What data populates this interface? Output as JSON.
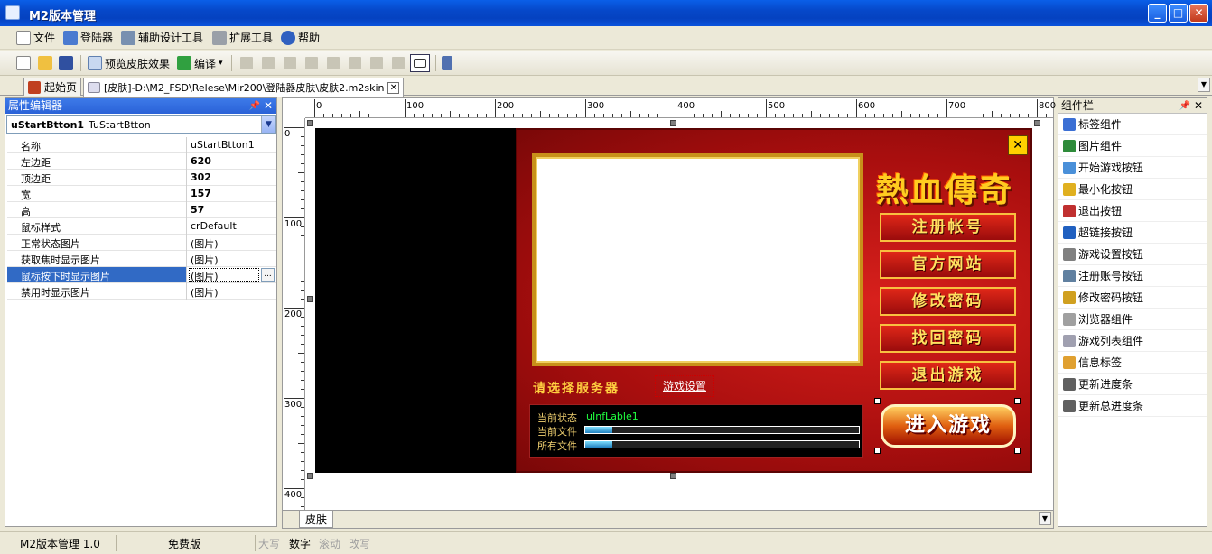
{
  "window": {
    "title": "M2版本管理",
    "min_label": "_",
    "max_label": "□",
    "close_label": "✕"
  },
  "menu": [
    {
      "label": "文件",
      "icon": "file-icon"
    },
    {
      "label": "登陆器",
      "icon": "monitor-icon"
    },
    {
      "label": "辅助设计工具",
      "icon": "tools-icon"
    },
    {
      "label": "扩展工具",
      "icon": "wrench-icon"
    },
    {
      "label": "帮助",
      "icon": "help-icon"
    }
  ],
  "toolbar": {
    "preview_label": "预览皮肤效果",
    "compile_label": "编译",
    "compile_arrow": "▾"
  },
  "tabs": [
    {
      "label": "起始页",
      "icon": "home-icon"
    },
    {
      "label": "[皮肤]-D:\\M2_FSD\\Relese\\Mir200\\登陆器皮肤\\皮肤2.m2skin",
      "icon": "doc-icon"
    }
  ],
  "tab_close": "✕",
  "tab_scroll": "▼",
  "inspector": {
    "title": "属性编辑器",
    "pin": "📌",
    "close": "✕",
    "object_name": "uStartBtton1",
    "object_class": "TuStartBtton",
    "dropdown": "▼",
    "ellipsis": "...",
    "props": [
      {
        "key": "名称",
        "value": "uStartBtton1",
        "bold": false
      },
      {
        "key": "左边距",
        "value": "620",
        "bold": true
      },
      {
        "key": "顶边距",
        "value": "302",
        "bold": true
      },
      {
        "key": "宽",
        "value": "157",
        "bold": true
      },
      {
        "key": "高",
        "value": "57",
        "bold": true
      },
      {
        "key": "鼠标样式",
        "value": "crDefault",
        "bold": false
      },
      {
        "key": "正常状态图片",
        "value": "(图片)",
        "bold": false
      },
      {
        "key": "获取焦时显示图片",
        "value": "(图片)",
        "bold": false
      },
      {
        "key": "鼠标按下时显示图片",
        "value": "(图片)",
        "bold": false,
        "selected": true
      },
      {
        "key": "禁用时显示图片",
        "value": "(图片)",
        "bold": false
      }
    ]
  },
  "ruler": {
    "top": [
      "0",
      "100",
      "200",
      "300",
      "400",
      "500",
      "600",
      "700",
      "800"
    ],
    "left": [
      "0",
      "100",
      "200",
      "300",
      "400"
    ]
  },
  "skin": {
    "close": "✕",
    "brand": "熱血傳奇",
    "buttons": [
      "注册帐号",
      "官方网站",
      "修改密码",
      "找回密码",
      "退出游戏"
    ],
    "server_label": "请选择服务器",
    "settings_label": "游戏设置",
    "status_label": "当前状态",
    "status_value": "uInfLable1",
    "file_label": "当前文件",
    "all_files_label": "所有文件",
    "current_file_progress": 0.1,
    "all_files_progress": 0.1,
    "enter_label": "进入游戏"
  },
  "designer_tab": "皮肤",
  "designer_scroll": "▼",
  "components": {
    "title": "组件栏",
    "pin": "📌",
    "close": "✕",
    "items": [
      {
        "label": "标签组件",
        "color": "#3b6fd4"
      },
      {
        "label": "图片组件",
        "color": "#2e8b3a"
      },
      {
        "label": "开始游戏按钮",
        "color": "#4a90d9"
      },
      {
        "label": "最小化按钮",
        "color": "#e0b020"
      },
      {
        "label": "退出按钮",
        "color": "#c03030"
      },
      {
        "label": "超链接按钮",
        "color": "#2060c0"
      },
      {
        "label": "游戏设置按钮",
        "color": "#808080"
      },
      {
        "label": "注册账号按钮",
        "color": "#6080a0"
      },
      {
        "label": "修改密码按钮",
        "color": "#d0a020"
      },
      {
        "label": "浏览器组件",
        "color": "#a0a0a0"
      },
      {
        "label": "游戏列表组件",
        "color": "#a0a0b0"
      },
      {
        "label": "信息标签",
        "color": "#e0a030"
      },
      {
        "label": "更新进度条",
        "color": "#606060"
      },
      {
        "label": "更新总进度条",
        "color": "#606060"
      }
    ]
  },
  "statusbar": {
    "app": "M2版本管理 1.0",
    "license": "免费版",
    "caps": "大写",
    "num": "数字",
    "scroll": "滚动",
    "overwrite": "改写"
  }
}
